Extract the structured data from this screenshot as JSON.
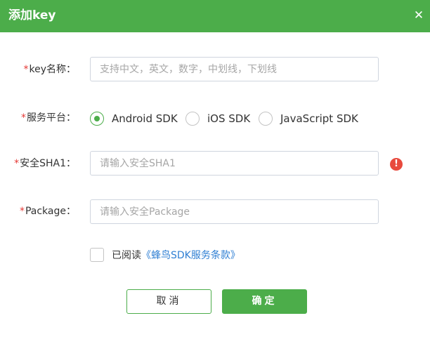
{
  "dialog": {
    "title": "添加key",
    "close_glyph": "✕"
  },
  "form": {
    "required_mark": "*",
    "key_name": {
      "label": "key名称：",
      "value": "",
      "placeholder": "支持中文，英文，数字，中划线，下划线"
    },
    "platform": {
      "label": "服务平台：",
      "options": [
        {
          "label": "Android SDK",
          "checked": true
        },
        {
          "label": "iOS SDK",
          "checked": false
        },
        {
          "label": "JavaScript SDK",
          "checked": false
        }
      ]
    },
    "sha1": {
      "label": "安全SHA1：",
      "value": "",
      "placeholder": "请输入安全SHA1",
      "warning_icon": "alert-circle-icon",
      "warning_glyph": "!"
    },
    "package": {
      "label": "Package：",
      "value": "",
      "placeholder": "请输入安全Package"
    },
    "agreement": {
      "checked": false,
      "text": "已阅读",
      "link_text": "《蜂鸟SDK服务条款》"
    }
  },
  "buttons": {
    "cancel_label": "取消",
    "confirm_label": "确定"
  },
  "colors": {
    "brand_green": "#4cad4a",
    "required_red": "#e53935",
    "warning_red": "#e84a3d",
    "link_blue": "#2f7fd3"
  }
}
